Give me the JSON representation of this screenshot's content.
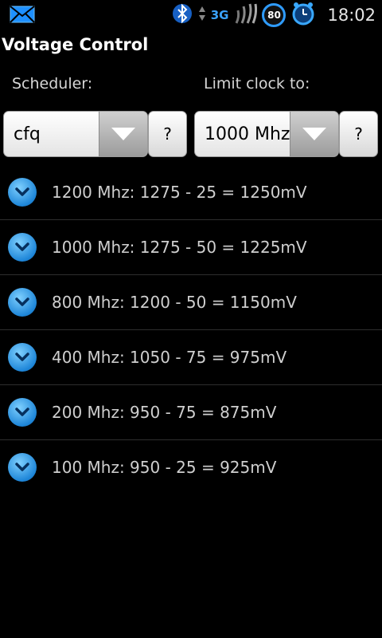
{
  "status_bar": {
    "network": "3G",
    "battery": "80",
    "time": "18:02",
    "icons": [
      "mail-icon",
      "bluetooth-icon",
      "data-arrows-icon",
      "signal-icon",
      "battery-icon",
      "alarm-clock-icon"
    ]
  },
  "app": {
    "title": "Voltage Control"
  },
  "scheduler": {
    "label": "Scheduler:",
    "value": "cfq",
    "help": "?"
  },
  "limit": {
    "label": "Limit clock to:",
    "value": "1000 Mhz",
    "help": "?"
  },
  "voltages": [
    "1200 Mhz: 1275 - 25 = 1250mV",
    "1000 Mhz: 1275 - 50 = 1225mV",
    "800 Mhz: 1200 - 50 = 1150mV",
    "400 Mhz: 1050 - 75 = 975mV",
    "200 Mhz: 950 - 75 = 875mV",
    "100 Mhz: 950 - 25 = 925mV"
  ],
  "colors": {
    "accent": "#2f9cff",
    "background": "#000000"
  }
}
